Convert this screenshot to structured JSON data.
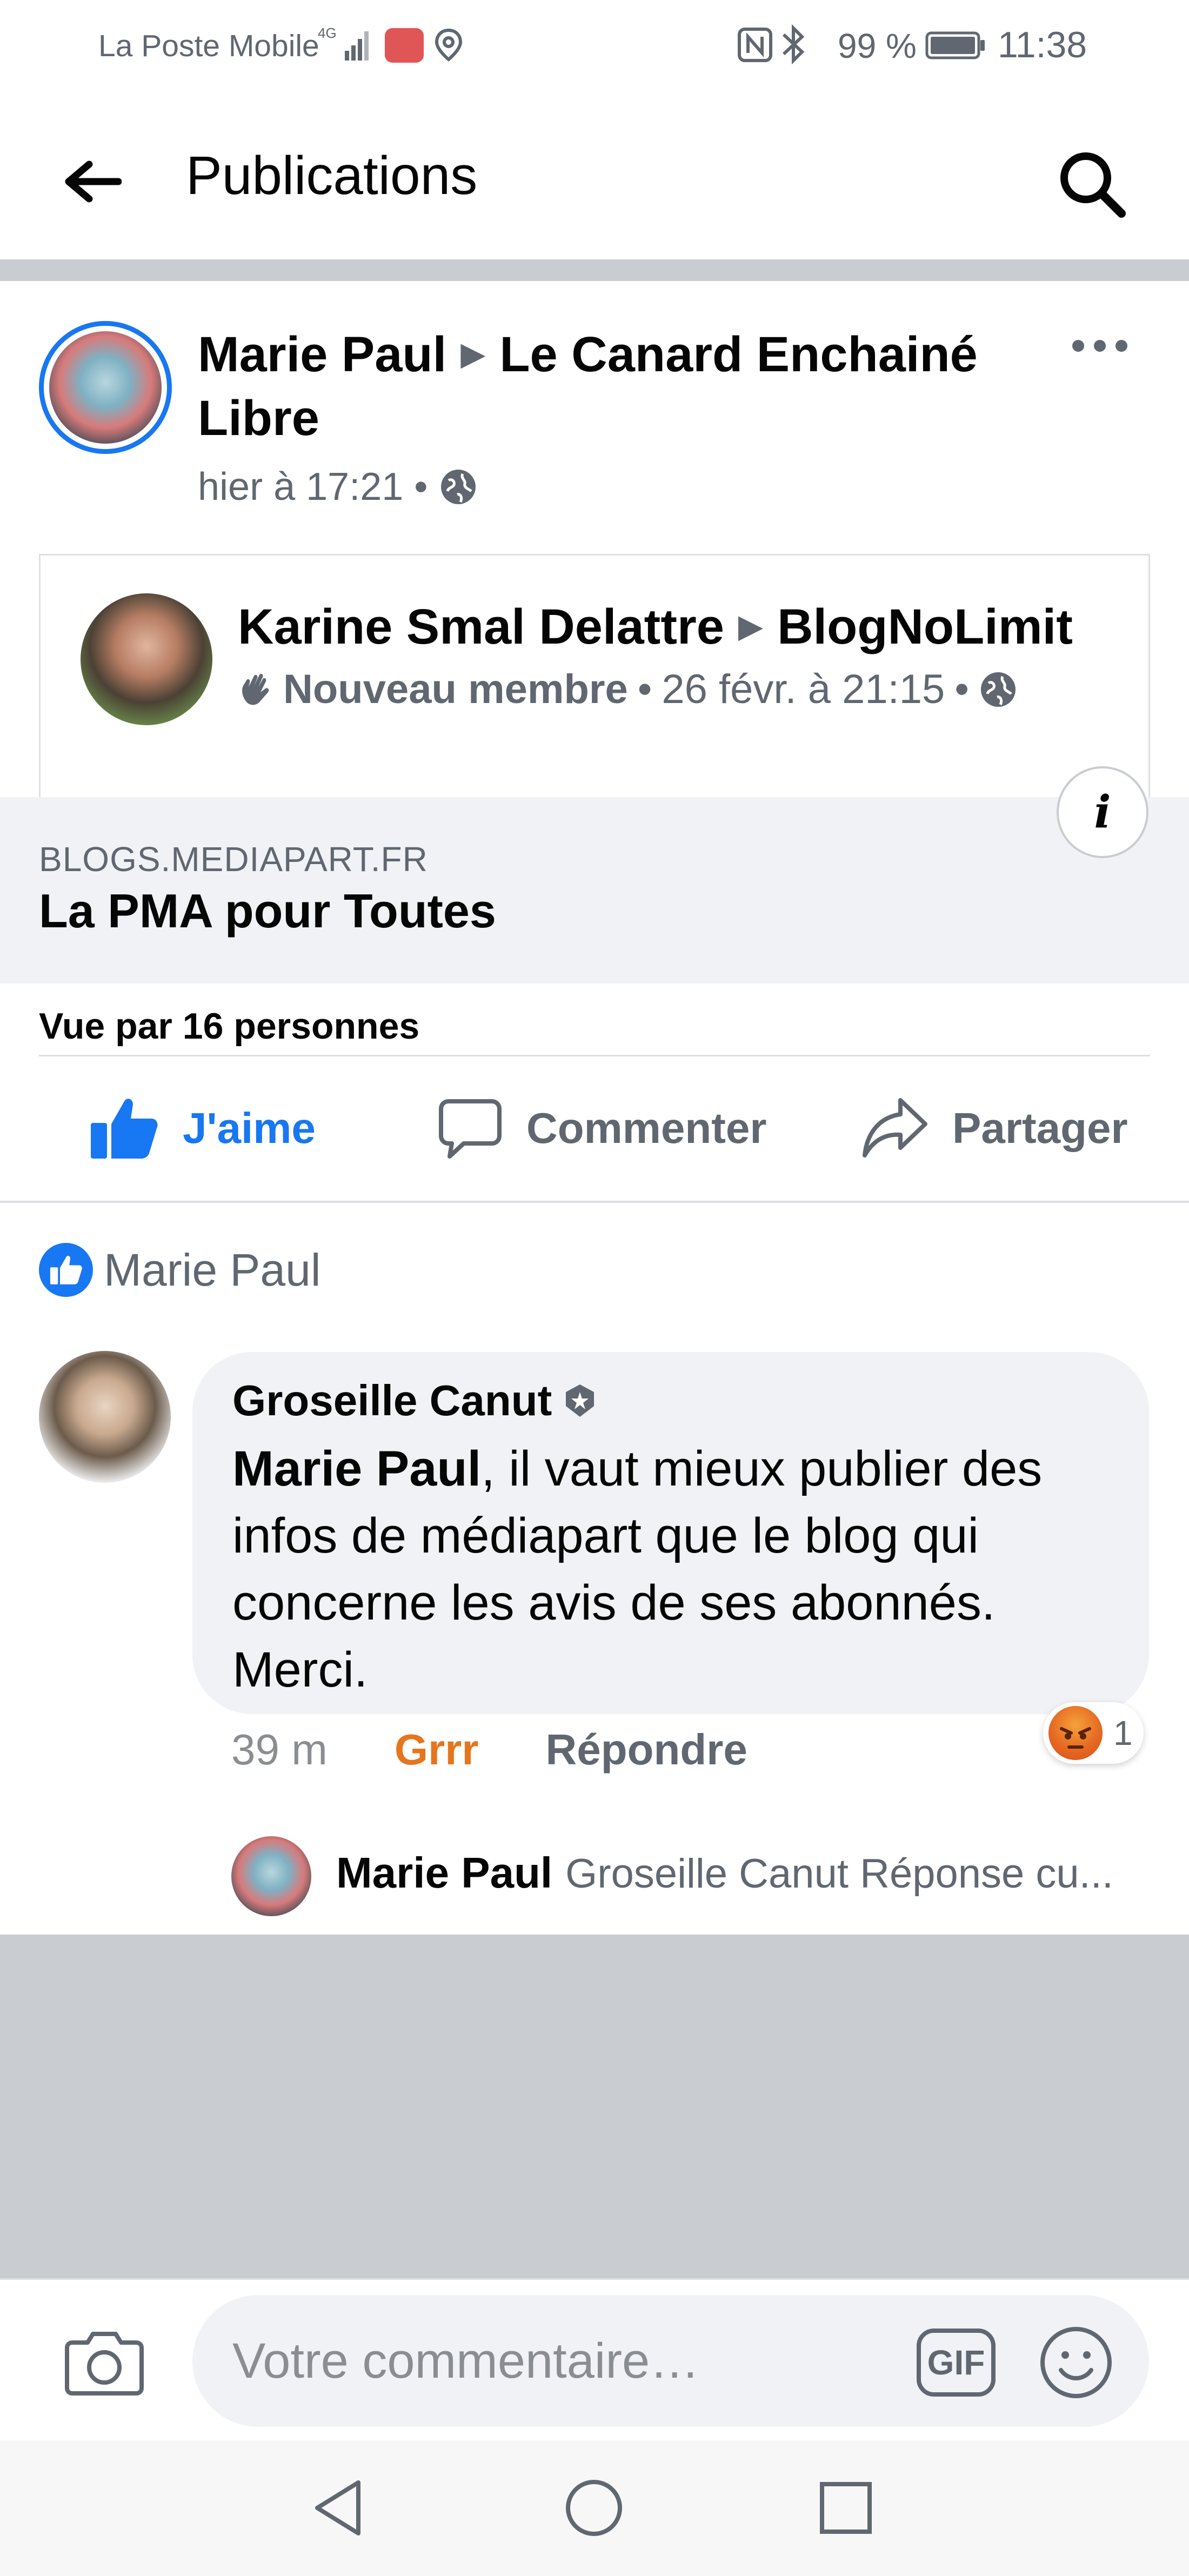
{
  "status_bar": {
    "carrier": "La Poste Mobile",
    "network": "4G",
    "battery_percent": "99 %",
    "time": "11:38"
  },
  "header": {
    "title": "Publications",
    "back_icon": "arrow-left-icon",
    "search_icon": "search-icon"
  },
  "post": {
    "author": "Marie Paul",
    "group": "Le Canard Enchainé Libre",
    "timestamp": "hier à 17:21",
    "privacy_icon": "globe-icon",
    "more_icon": "more-horizontal-icon",
    "shared": {
      "author": "Karine Smal Delattre",
      "group": "BlogNoLimit",
      "badge": "Nouveau membre",
      "timestamp": "26 févr. à 21:15",
      "badge_icon": "waving-hand-icon"
    },
    "link": {
      "domain": "BLOGS.MEDIAPART.FR",
      "title": "La PMA pour Toutes",
      "info_label": "i"
    },
    "views": "Vue par 16 personnes",
    "actions": {
      "like": "J'aime",
      "comment": "Commenter",
      "share": "Partager"
    }
  },
  "reactions": {
    "liked_by": "Marie Paul"
  },
  "comment": {
    "author": "Groseille Canut",
    "mention": "Marie Paul",
    "text": ", il vaut mieux publier des infos de médiapart que le blog qui concerne les avis de ses abonnés. Merci.",
    "time": "39 m",
    "reaction_label": "Grrr",
    "reply_label": "Répondre",
    "reaction_count": "1"
  },
  "reply_preview": {
    "author": "Marie Paul",
    "preview": "Groseille Canut Réponse cu..."
  },
  "composer": {
    "placeholder": "Votre commentaire…",
    "gif_label": "GIF"
  },
  "colors": {
    "accent": "#1877f2",
    "reaction_orange": "#e5761e",
    "secondary_text": "#606770",
    "bubble_bg": "#f0f2f5",
    "divider": "#c9ccd1"
  }
}
